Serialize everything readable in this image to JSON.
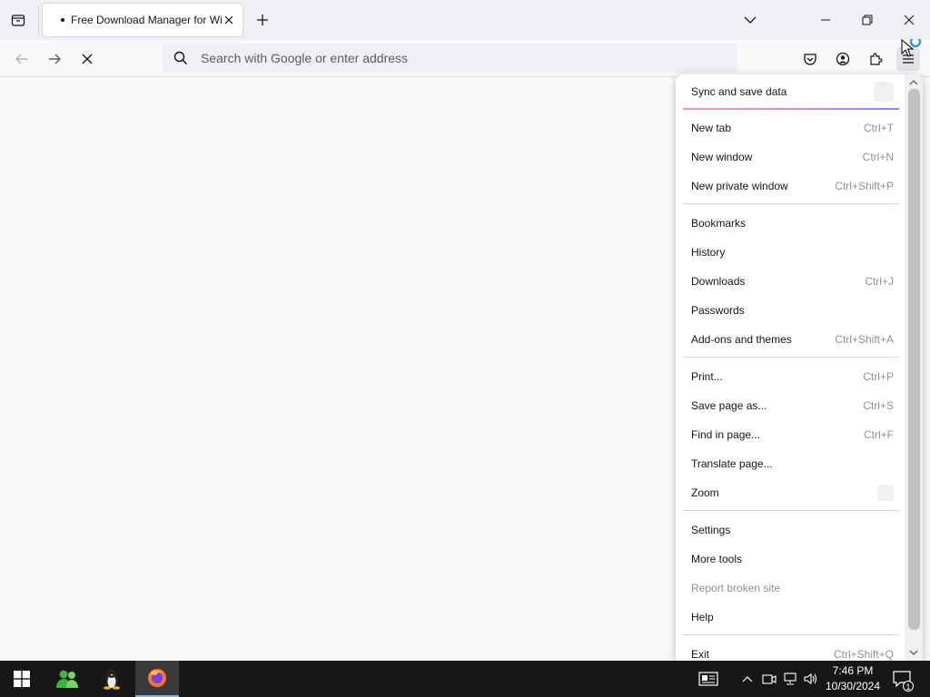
{
  "browser": {
    "tab": {
      "title": "Free Download Manager for Wi",
      "loading": true
    },
    "urlbar": {
      "placeholder": "Search with Google or enter address",
      "value": ""
    }
  },
  "app_menu": {
    "sync": {
      "label": "Sync and save data"
    },
    "groups": [
      [
        {
          "label": "New tab",
          "shortcut": "Ctrl+T"
        },
        {
          "label": "New window",
          "shortcut": "Ctrl+N"
        },
        {
          "label": "New private window",
          "shortcut": "Ctrl+Shift+P"
        }
      ],
      [
        {
          "label": "Bookmarks",
          "shortcut": ""
        },
        {
          "label": "History",
          "shortcut": ""
        },
        {
          "label": "Downloads",
          "shortcut": "Ctrl+J"
        },
        {
          "label": "Passwords",
          "shortcut": ""
        },
        {
          "label": "Add-ons and themes",
          "shortcut": "Ctrl+Shift+A"
        }
      ],
      [
        {
          "label": "Print...",
          "shortcut": "Ctrl+P"
        },
        {
          "label": "Save page as...",
          "shortcut": "Ctrl+S"
        },
        {
          "label": "Find in page...",
          "shortcut": "Ctrl+F"
        },
        {
          "label": "Translate page...",
          "shortcut": ""
        },
        {
          "label": "Zoom",
          "shortcut": ""
        }
      ],
      [
        {
          "label": "Settings",
          "shortcut": ""
        },
        {
          "label": "More tools",
          "shortcut": ""
        },
        {
          "label": "Report broken site",
          "shortcut": "",
          "disabled": true
        },
        {
          "label": "Help",
          "shortcut": ""
        }
      ],
      [
        {
          "label": "Exit",
          "shortcut": "Ctrl+Shift+Q"
        }
      ]
    ]
  },
  "taskbar": {
    "clock": {
      "time": "7:46 PM",
      "date": "10/30/2024"
    },
    "notification_count": "1"
  },
  "colors": {
    "accent": "#0060df",
    "taskbar_bg": "#171717",
    "menu_bg": "#ffffff"
  }
}
